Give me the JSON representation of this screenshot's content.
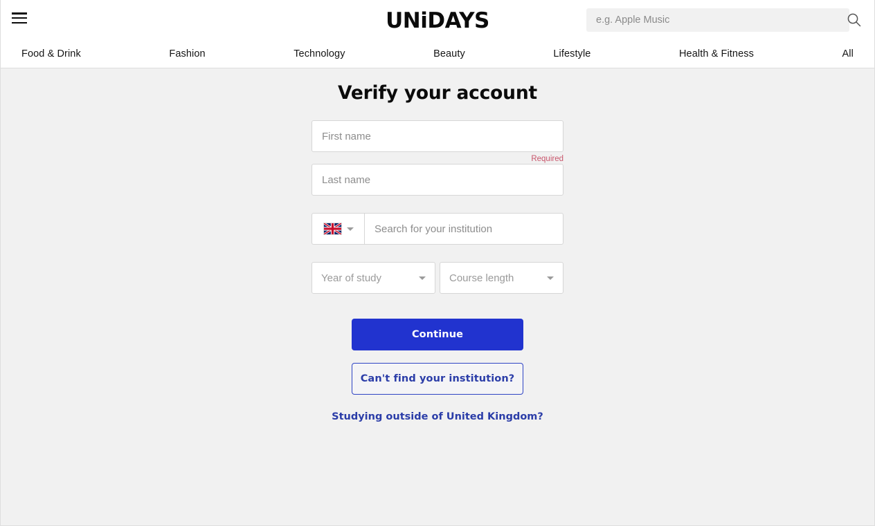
{
  "brand": {
    "name": "UNiDAYS",
    "part1": "UN",
    "part_i": "i",
    "part2": "DAYS"
  },
  "header": {
    "menu_icon": "hamburger-icon",
    "search": {
      "placeholder": "e.g. Apple Music",
      "value": "",
      "icon": "search-icon"
    }
  },
  "nav": {
    "items": [
      {
        "label": "Food & Drink"
      },
      {
        "label": "Fashion"
      },
      {
        "label": "Technology"
      },
      {
        "label": "Beauty"
      },
      {
        "label": "Lifestyle"
      },
      {
        "label": "Health & Fitness"
      },
      {
        "label": "All"
      }
    ]
  },
  "main": {
    "title": "Verify your account",
    "first_name": {
      "placeholder": "First name",
      "value": "",
      "error": "Required"
    },
    "last_name": {
      "placeholder": "Last name",
      "value": ""
    },
    "country": {
      "selected": "United Kingdom",
      "flag_icon": "uk-flag-icon",
      "caret_icon": "chevron-down-icon"
    },
    "institution": {
      "placeholder": "Search for your institution",
      "value": ""
    },
    "year_of_study": {
      "placeholder": "Year of study",
      "value": "",
      "caret_icon": "chevron-down-icon"
    },
    "course_length": {
      "placeholder": "Course length",
      "value": "",
      "caret_icon": "chevron-down-icon"
    },
    "continue_button": "Continue",
    "cant_find_button": "Can't find your institution?",
    "outside_link": "Studying outside of United Kingdom?"
  },
  "colors": {
    "primary_blue": "#2133cf",
    "link_blue": "#2b3da8",
    "error_red": "#c8556b",
    "page_bg": "#f1f1f1",
    "header_bg": "#ffffff"
  }
}
